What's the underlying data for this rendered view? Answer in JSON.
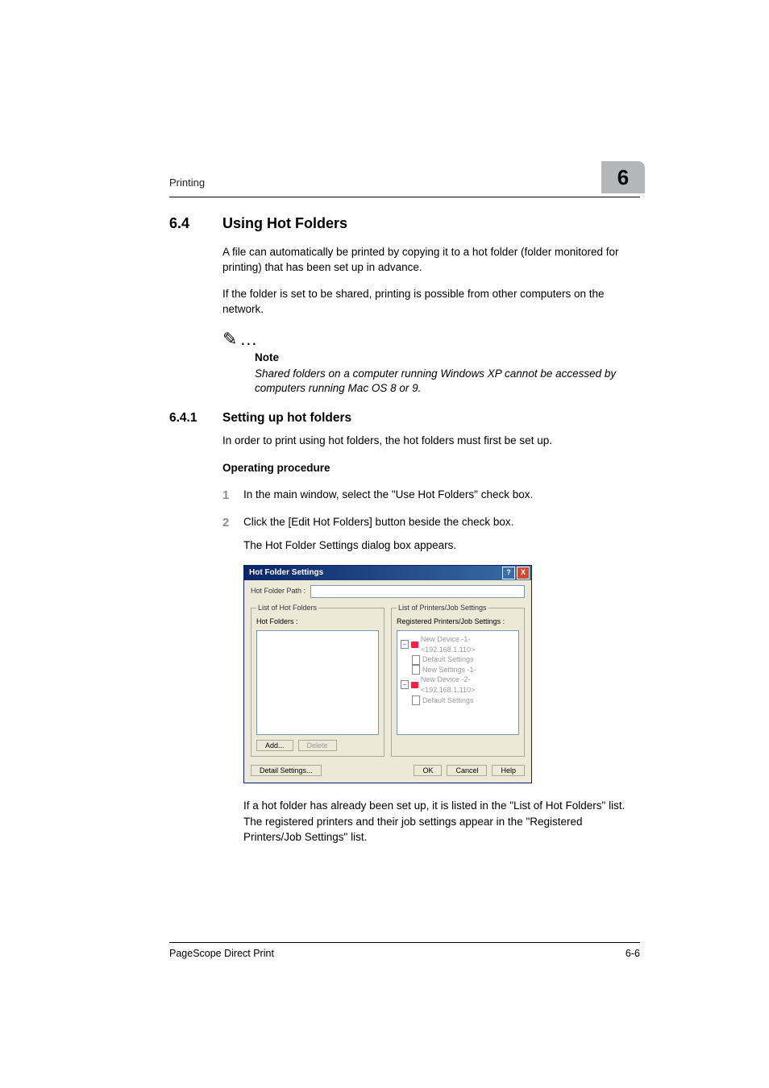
{
  "header": {
    "section_label": "Printing",
    "chapter_number": "6"
  },
  "section": {
    "number": "6.4",
    "title": "Using Hot Folders",
    "para1": "A file can automatically be printed by copying it to a hot folder (folder monitored for printing) that has been set up in advance.",
    "para2": "If the folder is set to be shared, printing is possible from other computers on the network."
  },
  "note": {
    "icon": "✎…",
    "heading": "Note",
    "body": "Shared folders on a computer running Windows XP cannot be accessed by computers running Mac OS 8 or 9."
  },
  "subsection": {
    "number": "6.4.1",
    "title": "Setting up hot folders",
    "intro": "In order to print using hot folders, the hot folders must first be set up.",
    "op_heading": "Operating procedure"
  },
  "steps": [
    {
      "text": "In the main window, select the \"Use Hot Folders\" check box."
    },
    {
      "text": "Click the [Edit Hot Folders] button beside the check box.",
      "sub": "The Hot Folder Settings dialog box appears.",
      "after": "If a hot folder has already been set up, it is listed in the \"List of Hot Folders\" list. The registered printers and their job settings appear in the \"Registered Printers/Job Settings\" list."
    }
  ],
  "dialog": {
    "title": "Hot Folder Settings",
    "help_label": "?",
    "close_label": "X",
    "path_label": "Hot Folder Path :",
    "path_value": "",
    "left_group": "List of Hot Folders",
    "left_list_label": "Hot Folders :",
    "add_label": "Add...",
    "delete_label": "Delete",
    "right_group": "List of Printers/Job Settings",
    "right_list_label": "Registered Printers/Job Settings :",
    "tree": [
      {
        "type": "printer",
        "label": "New Device -1- <192.168.1.110>"
      },
      {
        "type": "settings",
        "label": "Default Settings"
      },
      {
        "type": "settings",
        "label": "New Settings -1-"
      },
      {
        "type": "printer",
        "label": "New Device -2- <192.168.1.110>"
      },
      {
        "type": "settings",
        "label": "Default Settings"
      }
    ],
    "detail_label": "Detail Settings...",
    "ok_label": "OK",
    "cancel_label": "Cancel",
    "help_btn_label": "Help"
  },
  "footer": {
    "left": "PageScope Direct Print",
    "right": "6-6"
  }
}
